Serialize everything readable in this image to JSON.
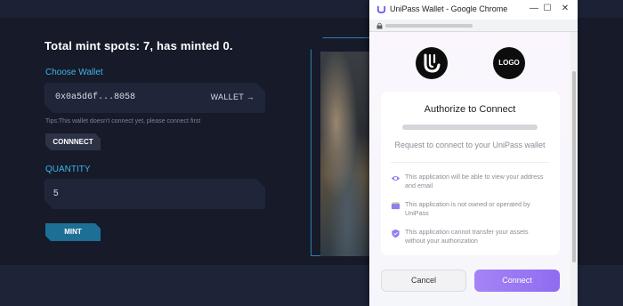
{
  "mint": {
    "title": "Total mint spots: 7, has minted 0.",
    "choose_wallet_label": "Choose Wallet",
    "wallet_address": "0x0a5d6f...8058",
    "wallet_link": "WALLET →",
    "tips": "Tips:This wallet doesn't connect yet, please connect first",
    "connect_label": "CONNNECT",
    "quantity_label": "QUANTITY",
    "quantity_value": "5",
    "mint_label": "MINT"
  },
  "popup": {
    "window_title": "UniPass Wallet - Google Chrome",
    "controls": {
      "minimize": "—",
      "maximize": "☐",
      "close": "✕"
    },
    "app_logo_text": "LOGO",
    "card_title": "Authorize to Connect",
    "request_text": "Request to connect to your UniPass wallet",
    "permissions": [
      {
        "icon": "eye-icon",
        "text": "This application will be able to view your address and email"
      },
      {
        "icon": "card-icon",
        "text": "This application is not owned or operated by UniPass"
      },
      {
        "icon": "shield-icon",
        "text": "This application cannot transfer your assets without your authorization"
      }
    ],
    "cancel_label": "Cancel",
    "connect_label": "Connect"
  },
  "colors": {
    "accent_blue": "#3fb6e8",
    "mint_button": "#1d6f95",
    "popup_connect": "#9a78f3"
  }
}
